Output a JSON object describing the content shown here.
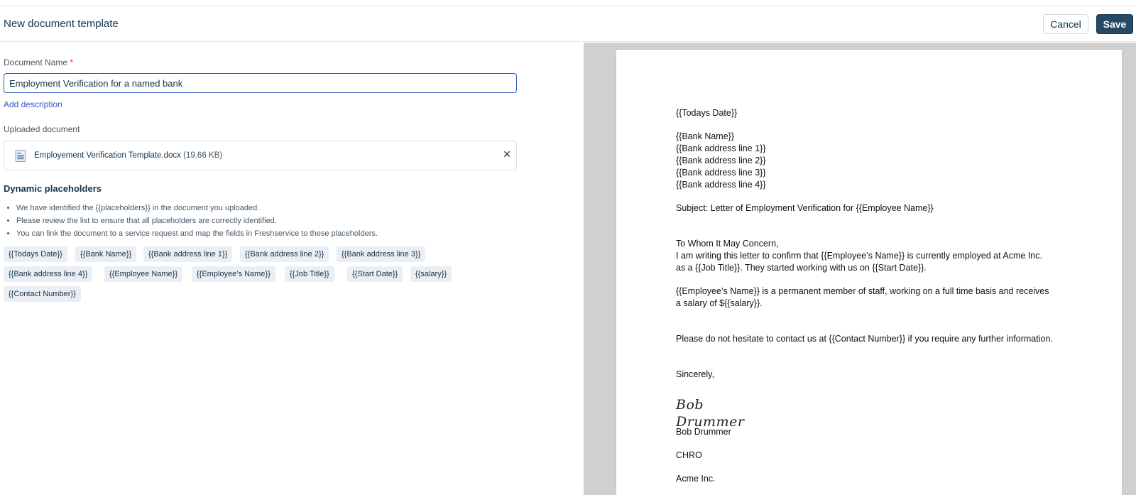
{
  "header": {
    "title": "New document template",
    "cancel_label": "Cancel",
    "save_label": "Save"
  },
  "form": {
    "name_label": "Document Name",
    "required_mark": "*",
    "name_value": "Employment Verification for a named bank",
    "add_description_label": "Add description",
    "uploaded_label": "Uploaded document",
    "file": {
      "icon": "document-icon",
      "name": "Employement Verification Template.docx",
      "size": "(19.66 KB)"
    }
  },
  "placeholders": {
    "title": "Dynamic placeholders",
    "bullets": [
      "We have identified the {{placeholders}} in the document you uploaded.",
      "Please review the list to ensure that all placeholders are correctly identified.",
      "You can link the document to a service request and map the fields in Freshservice to these placeholders."
    ],
    "chips": [
      "{{Todays Date}}",
      "{{Bank Name}}",
      "{{Bank address line 1}}",
      "{{Bank address line 2}}",
      "{{Bank address line 3}}",
      "{{Bank address line 4}}",
      "{{Employee Name}}",
      "{{Employee’s Name}}",
      "{{Job Title}}",
      "{{Start Date}}",
      "{{salary}}",
      "{{Contact Number}}"
    ]
  },
  "preview": {
    "date": "{{Todays Date}}",
    "bank_name": "{{Bank Name}}",
    "addr1": "{{Bank address line 1}}",
    "addr2": "{{Bank address line 2}}",
    "addr3": "{{Bank address line 3}}",
    "addr4": "{{Bank address line 4}}",
    "subject": "Subject: Letter of Employment Verification for {{Employee Name}}",
    "salutation": "To Whom It May Concern,",
    "para1_line1": "I am writing this letter to confirm that {{Employee’s Name}} is currently employed at Acme Inc.",
    "para1_line2": "as a {{Job Title}}. They started working with us on {{Start Date}}.",
    "para2_line1": "{{Employee’s Name}} is a permanent member of staff, working on a full time basis and receives",
    "para2_line2": "a salary of ${{salary}}.",
    "para3": "Please do not hesitate to contact us at {{Contact Number}} if you require any further information.",
    "closing": "Sincerely,",
    "signature_line1": "Bob",
    "signature_line2": "Drummer",
    "signer_name": "Bob Drummer",
    "signer_title": "CHRO",
    "company": "Acme Inc."
  }
}
